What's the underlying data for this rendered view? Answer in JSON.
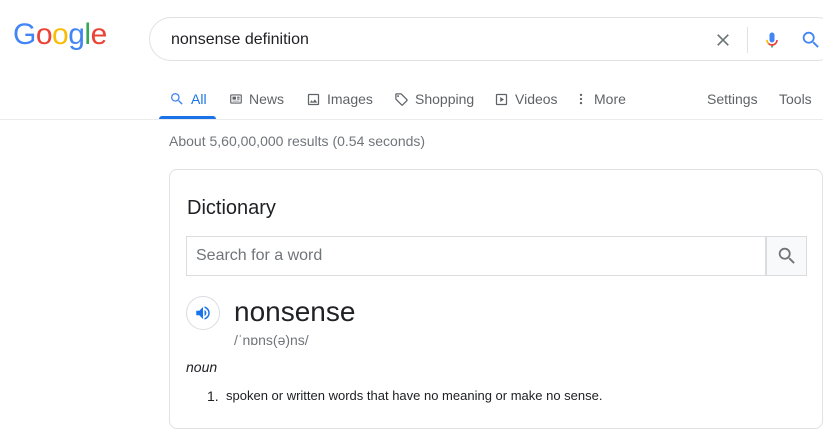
{
  "logo": {
    "text": "Google",
    "letters": [
      "G",
      "o",
      "o",
      "g",
      "l",
      "e"
    ],
    "colors": [
      "#4285f4",
      "#ea4335",
      "#fbbc05",
      "#4285f4",
      "#34a853",
      "#ea4335"
    ]
  },
  "search": {
    "query": "nonsense definition"
  },
  "tabs": [
    {
      "label": "All",
      "icon": "search-icon",
      "active": true
    },
    {
      "label": "News",
      "icon": "news-icon"
    },
    {
      "label": "Images",
      "icon": "image-icon"
    },
    {
      "label": "Shopping",
      "icon": "tag-icon"
    },
    {
      "label": "Videos",
      "icon": "play-icon"
    },
    {
      "label": "More",
      "icon": "more-vert-icon"
    }
  ],
  "tools": {
    "settings": "Settings",
    "tools": "Tools"
  },
  "stats": "About 5,60,00,000 results (0.54 seconds)",
  "dictionary": {
    "title": "Dictionary",
    "search_placeholder": "Search for a word",
    "word": "nonsense",
    "phonetic": "/ˈnɒns(ə)ns/",
    "part_of_speech": "noun",
    "definitions": [
      {
        "number": "1.",
        "text": "spoken or written words that have no meaning or make no sense."
      }
    ]
  },
  "colors": {
    "accent": "#1a73e8",
    "muted": "#5f6368",
    "border": "#dfe1e5"
  }
}
